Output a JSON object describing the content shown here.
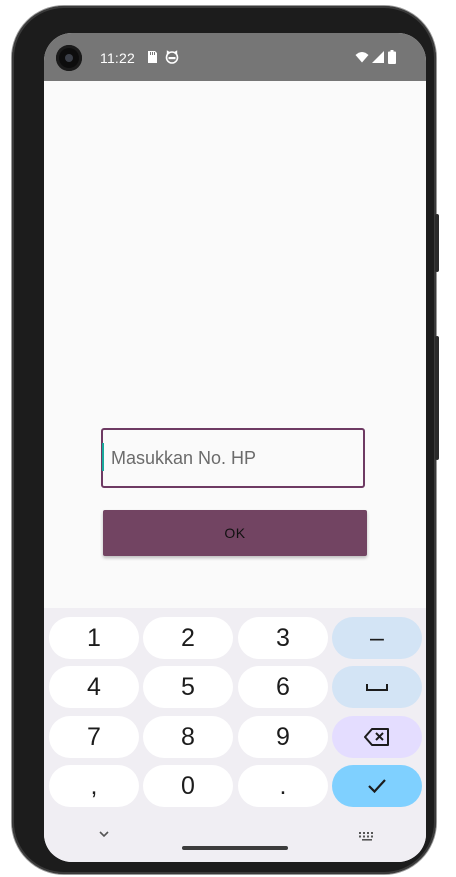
{
  "status_bar": {
    "time": "11:22",
    "icons_left": [
      "sd-card-icon",
      "cat-face-icon"
    ],
    "icons_right": [
      "wifi-icon",
      "cell-signal-icon",
      "battery-icon"
    ]
  },
  "form": {
    "phone_placeholder": "Masukkan No. HP",
    "phone_value": "",
    "ok_label": "OK"
  },
  "keyboard": {
    "keys": [
      "1",
      "2",
      "3",
      "4",
      "5",
      "6",
      "7",
      "8",
      "9",
      ",",
      "0",
      "."
    ],
    "function_keys": [
      "minus-key",
      "space-key",
      "backspace-key",
      "enter-key"
    ],
    "minus_label": "–"
  },
  "colors": {
    "status_bar": "#767676",
    "accent": "#724462",
    "input_border": "#6e3a63",
    "cursor": "#1aa89c",
    "key_fn": "#d3e4f5",
    "key_delete": "#e4ddff",
    "key_enter": "#7fd0ff"
  }
}
